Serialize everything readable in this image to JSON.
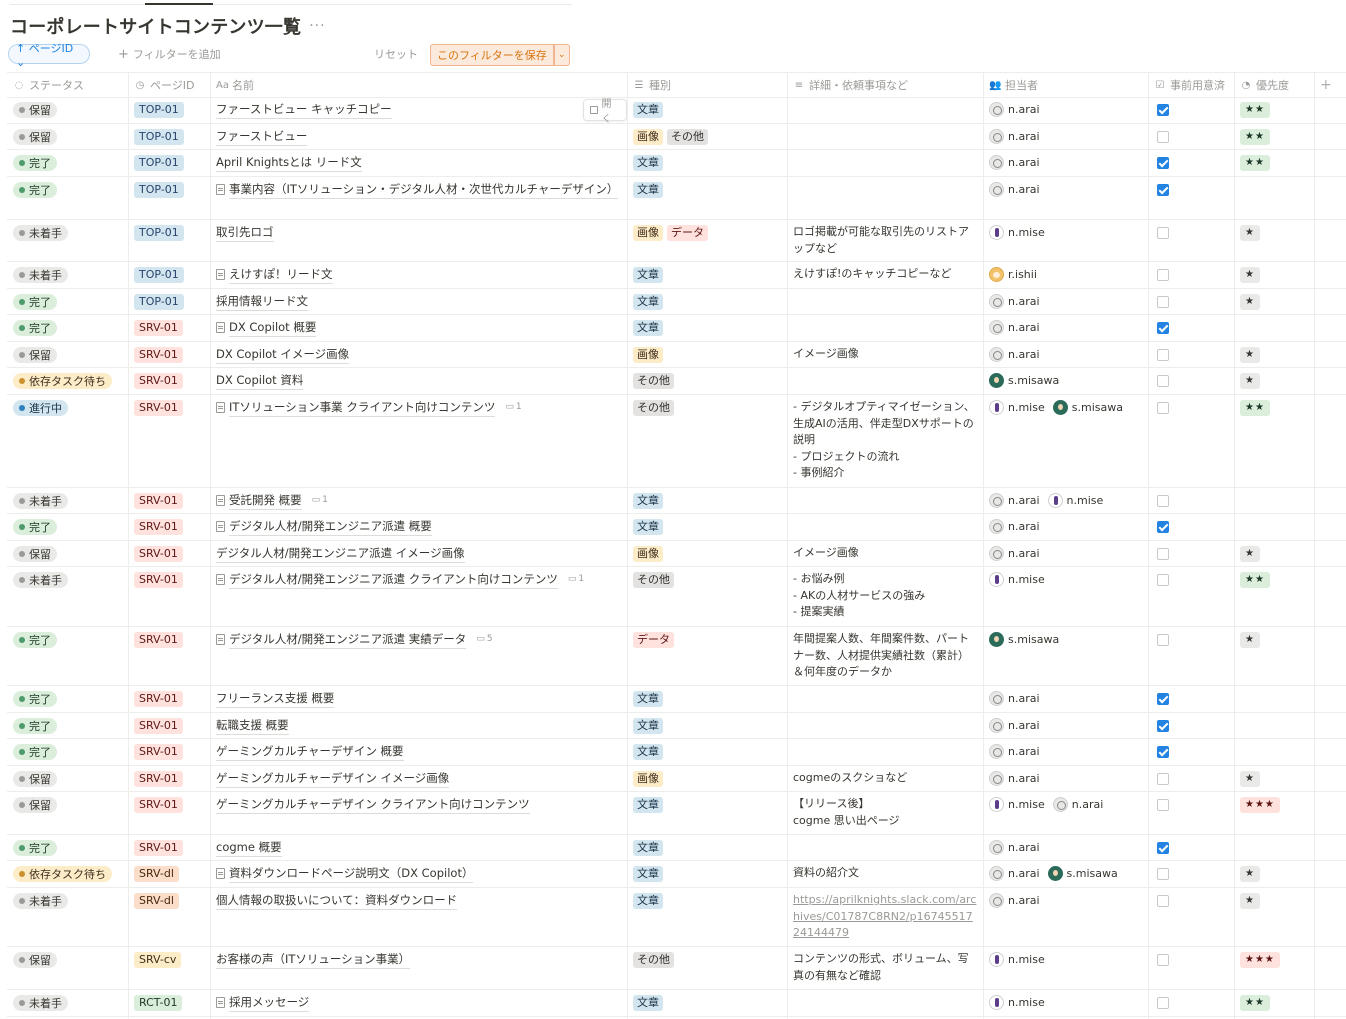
{
  "page": {
    "title": "コーポレートサイトコンテンツ一覧",
    "more_icon": "ellipsis-icon"
  },
  "toolbar": {
    "sort_chip": "↑ ページID ⌄",
    "add_filter": "フィルターを追加",
    "reset": "リセット",
    "save_filter": "このフィルターを保存",
    "save_arrow": "⌄"
  },
  "columns": [
    {
      "label": "ステータス",
      "icon": "◌"
    },
    {
      "label": "ページID",
      "icon": "◷"
    },
    {
      "label": "名前",
      "icon": "Aa"
    },
    {
      "label": "種別",
      "icon": "☰"
    },
    {
      "label": "詳細・依頼事項など",
      "icon": "≡"
    },
    {
      "label": "担当者",
      "icon": "👥"
    },
    {
      "label": "事前用意済",
      "icon": "☑"
    },
    {
      "label": "優先度",
      "icon": "◔"
    }
  ],
  "add_column": "+",
  "open_button": "開く",
  "colors": {
    "status": {
      "保留": {
        "bg": "#e9e9e7",
        "dot": "#9b9a97",
        "fg": "#37352f"
      },
      "完了": {
        "bg": "#dbeddb",
        "dot": "#4d9a6a",
        "fg": "#1c3829"
      },
      "未着手": {
        "bg": "#e9e9e7",
        "dot": "#9b9a97",
        "fg": "#37352f"
      },
      "依存タスク待ち": {
        "bg": "#fdecc8",
        "dot": "#cb912f",
        "fg": "#402c1b"
      },
      "進行中": {
        "bg": "#d3e5ef",
        "dot": "#2f80c0",
        "fg": "#183347"
      }
    },
    "pid": {
      "TOP-01": {
        "bg": "#d3e5ef",
        "fg": "#28456c"
      },
      "SRV-01": {
        "bg": "#ffe2dd",
        "fg": "#5d1715"
      },
      "SRV-dl": {
        "bg": "#fadec9",
        "fg": "#49290e"
      },
      "SRV-cv": {
        "bg": "#fdecc8",
        "fg": "#402c1b"
      },
      "RCT-01": {
        "bg": "#dbeddb",
        "fg": "#1c3829"
      }
    },
    "tag": {
      "文章": {
        "bg": "#d3e5ef",
        "fg": "#183347"
      },
      "画像": {
        "bg": "#fdecc8",
        "fg": "#402c1b"
      },
      "その他": {
        "bg": "#e3e2e0",
        "fg": "#32302c"
      },
      "データ": {
        "bg": "#ffe2dd",
        "fg": "#5d1715"
      }
    },
    "prio": {
      "★★": {
        "bg": "#dbeddb",
        "fg": "#1c3829"
      },
      "★": {
        "bg": "#e9e9e7",
        "fg": "#37352f"
      },
      "★★★": {
        "bg": "#ffe2dd",
        "fg": "#5d1715"
      }
    }
  },
  "rows": [
    {
      "status": "保留",
      "pid": "TOP-01",
      "name": "ファーストビュー キャッチコピー",
      "doc": false,
      "comments": "",
      "tags": [
        "文章"
      ],
      "detail": [],
      "people": [
        "n.arai"
      ],
      "checked": true,
      "prio": "★★",
      "h": 27
    },
    {
      "status": "保留",
      "pid": "TOP-01",
      "name": "ファーストビュー",
      "doc": false,
      "comments": "",
      "tags": [
        "画像",
        "その他"
      ],
      "detail": [],
      "people": [
        "n.arai"
      ],
      "checked": false,
      "prio": "★★",
      "h": 26
    },
    {
      "status": "完了",
      "pid": "TOP-01",
      "name": "April Knightsとは リード文",
      "doc": false,
      "comments": "",
      "tags": [
        "文章"
      ],
      "detail": [],
      "people": [
        "n.arai"
      ],
      "checked": true,
      "prio": "★★",
      "h": 27
    },
    {
      "status": "完了",
      "pid": "TOP-01",
      "name": "事業内容（ITソリューション・デジタル人材・次世代カルチャーデザイン）",
      "doc": true,
      "comments": "",
      "tags": [
        "文章"
      ],
      "detail": [],
      "people": [
        "n.arai"
      ],
      "checked": true,
      "prio": "",
      "h": 43
    },
    {
      "status": "未着手",
      "pid": "TOP-01",
      "name": "取引先ロゴ",
      "doc": false,
      "comments": "",
      "tags": [
        "画像",
        "データ"
      ],
      "detail": [
        "ロゴ掲載が可能な取引先のリストアップなど"
      ],
      "people": [
        "n.mise"
      ],
      "checked": false,
      "prio": "★",
      "h": 42
    },
    {
      "status": "未着手",
      "pid": "TOP-01",
      "name": "えけすぽ！リード文",
      "doc": true,
      "comments": "",
      "tags": [
        "文章"
      ],
      "detail": [
        "えけすぽ!のキャッチコピーなど"
      ],
      "people": [
        "r.ishii"
      ],
      "checked": false,
      "prio": "★",
      "h": 27
    },
    {
      "status": "完了",
      "pid": "TOP-01",
      "name": "採用情報リード文",
      "doc": false,
      "comments": "",
      "tags": [
        "文章"
      ],
      "detail": [],
      "people": [
        "n.arai"
      ],
      "checked": false,
      "prio": "★",
      "h": 26
    },
    {
      "status": "完了",
      "pid": "SRV-01",
      "name": "DX Copilot 概要",
      "doc": true,
      "comments": "",
      "tags": [
        "文章"
      ],
      "detail": [],
      "people": [
        "n.arai"
      ],
      "checked": true,
      "prio": "",
      "h": 27
    },
    {
      "status": "保留",
      "pid": "SRV-01",
      "name": "DX Copilot イメージ画像",
      "doc": false,
      "comments": "",
      "tags": [
        "画像"
      ],
      "detail": [
        "イメージ画像"
      ],
      "people": [
        "n.arai"
      ],
      "checked": false,
      "prio": "★",
      "h": 26
    },
    {
      "status": "依存タスク待ち",
      "pid": "SRV-01",
      "name": "DX Copilot 資料",
      "doc": false,
      "comments": "",
      "tags": [
        "その他"
      ],
      "detail": [],
      "people": [
        "s.misawa"
      ],
      "checked": false,
      "prio": "★",
      "h": 27
    },
    {
      "status": "進行中",
      "pid": "SRV-01",
      "name": "ITソリューション事業 クライアント向けコンテンツ",
      "doc": true,
      "comments": "1",
      "tags": [
        "その他"
      ],
      "detail": [
        "- デジタルオプティマイゼーション、生成AIの活用、伴走型DXサポートの説明",
        "- プロジェクトの流れ",
        "- 事例紹介"
      ],
      "people": [
        "n.mise",
        "s.misawa"
      ],
      "checked": false,
      "prio": "★★",
      "h": 93
    },
    {
      "status": "未着手",
      "pid": "SRV-01",
      "name": "受託開発 概要",
      "doc": true,
      "comments": "1",
      "tags": [
        "文章"
      ],
      "detail": [],
      "people": [
        "n.arai",
        "n.mise"
      ],
      "checked": false,
      "prio": "",
      "h": 26
    },
    {
      "status": "完了",
      "pid": "SRV-01",
      "name": "デジタル人材/開発エンジニア派遣 概要",
      "doc": true,
      "comments": "",
      "tags": [
        "文章"
      ],
      "detail": [],
      "people": [
        "n.arai"
      ],
      "checked": true,
      "prio": "",
      "h": 27
    },
    {
      "status": "保留",
      "pid": "SRV-01",
      "name": "デジタル人材/開発エンジニア派遣 イメージ画像",
      "doc": false,
      "comments": "",
      "tags": [
        "画像"
      ],
      "detail": [
        "イメージ画像"
      ],
      "people": [
        "n.arai"
      ],
      "checked": false,
      "prio": "★",
      "h": 26
    },
    {
      "status": "未着手",
      "pid": "SRV-01",
      "name": "デジタル人材/開発エンジニア派遣 クライアント向けコンテンツ",
      "doc": true,
      "comments": "1",
      "tags": [
        "その他"
      ],
      "detail": [
        "- お悩み例",
        "- AKの人材サービスの強み",
        "- 提案実績"
      ],
      "people": [
        "n.mise"
      ],
      "checked": false,
      "prio": "★★",
      "h": 60
    },
    {
      "status": "完了",
      "pid": "SRV-01",
      "name": "デジタル人材/開発エンジニア派遣 実績データ",
      "doc": true,
      "comments": "5",
      "tags": [
        "データ"
      ],
      "detail": [
        "年間提案人数、年間案件数、パートナー数、人材提供実績社数（累計）＆何年度のデータか"
      ],
      "people": [
        "s.misawa"
      ],
      "checked": false,
      "prio": "★",
      "h": 59
    },
    {
      "status": "完了",
      "pid": "SRV-01",
      "name": "フリーランス支援 概要",
      "doc": false,
      "comments": "",
      "tags": [
        "文章"
      ],
      "detail": [],
      "people": [
        "n.arai"
      ],
      "checked": true,
      "prio": "",
      "h": 27
    },
    {
      "status": "完了",
      "pid": "SRV-01",
      "name": "転職支援 概要",
      "doc": false,
      "comments": "",
      "tags": [
        "文章"
      ],
      "detail": [],
      "people": [
        "n.arai"
      ],
      "checked": true,
      "prio": "",
      "h": 26
    },
    {
      "status": "完了",
      "pid": "SRV-01",
      "name": "ゲーミングカルチャーデザイン 概要",
      "doc": false,
      "comments": "",
      "tags": [
        "文章"
      ],
      "detail": [],
      "people": [
        "n.arai"
      ],
      "checked": true,
      "prio": "",
      "h": 27
    },
    {
      "status": "保留",
      "pid": "SRV-01",
      "name": "ゲーミングカルチャーデザイン イメージ画像",
      "doc": false,
      "comments": "",
      "tags": [
        "画像"
      ],
      "detail": [
        "cogmeのスクショなど"
      ],
      "people": [
        "n.arai"
      ],
      "checked": false,
      "prio": "★",
      "h": 26
    },
    {
      "status": "保留",
      "pid": "SRV-01",
      "name": "ゲーミングカルチャーデザイン クライアント向けコンテンツ",
      "doc": false,
      "comments": "",
      "tags": [
        "文章"
      ],
      "detail": [
        "【リリース後】",
        "cogme 思い出ページ"
      ],
      "people": [
        "n.mise",
        "n.arai"
      ],
      "checked": false,
      "prio": "★★★",
      "h": 43
    },
    {
      "status": "完了",
      "pid": "SRV-01",
      "name": "cogme 概要",
      "doc": false,
      "comments": "",
      "tags": [
        "文章"
      ],
      "detail": [],
      "people": [
        "n.arai"
      ],
      "checked": true,
      "prio": "",
      "h": 26
    },
    {
      "status": "依存タスク待ち",
      "pid": "SRV-dl",
      "name": "資料ダウンロードページ説明文（DX Copilot）",
      "doc": true,
      "comments": "",
      "tags": [
        "文章"
      ],
      "detail": [
        "資料の紹介文"
      ],
      "people": [
        "n.arai",
        "s.misawa"
      ],
      "checked": false,
      "prio": "★",
      "h": 27
    },
    {
      "status": "未着手",
      "pid": "SRV-dl",
      "name": "個人情報の取扱いについて：資料ダウンロード",
      "doc": false,
      "comments": "",
      "tags": [
        "文章"
      ],
      "detail": [
        "https://aprilknights.slack.com/archives/C01787C8RN2/p1674551724144479"
      ],
      "link": true,
      "people": [
        "n.arai"
      ],
      "checked": false,
      "prio": "★",
      "h": 59
    },
    {
      "status": "保留",
      "pid": "SRV-cv",
      "name": "お客様の声（ITソリューション事業）",
      "doc": false,
      "comments": "",
      "tags": [
        "その他"
      ],
      "detail": [
        "コンテンツの形式、ボリューム、写真の有無など確認"
      ],
      "people": [
        "n.mise"
      ],
      "checked": false,
      "prio": "★★★",
      "h": 43
    },
    {
      "status": "未着手",
      "pid": "RCT-01",
      "name": "採用メッセージ",
      "doc": true,
      "comments": "",
      "tags": [
        "文章"
      ],
      "detail": [],
      "people": [
        "n.mise"
      ],
      "checked": false,
      "prio": "★★",
      "h": 27
    }
  ]
}
